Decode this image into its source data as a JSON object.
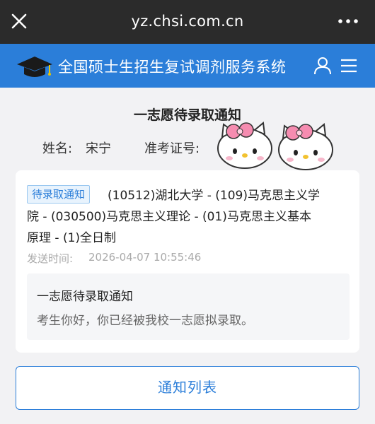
{
  "browser": {
    "url": "yz.chsi.com.cn",
    "close_icon": "close-icon",
    "more_icon": "more-horizontal-icon"
  },
  "header": {
    "title": "全国硕士生招生复试调剂服务系统",
    "logo_icon": "graduation-cap-icon",
    "user_icon": "user-icon",
    "menu_icon": "menu-icon",
    "color": "#2b7ed9"
  },
  "page": {
    "title": "一志愿待录取通知",
    "name_label": "姓名:",
    "name_value": "宋宁",
    "exam_no_label": "准考证号:"
  },
  "notice": {
    "badge": "待录取通知",
    "line1": "(10512)湖北大学 - (109)马克思主义学",
    "line2": "院 - (030500)马克思主义理论 - (01)马克思主义基本",
    "line3": "原理 - (1)全日制",
    "send_label": "发送时间:",
    "send_time": "2026-04-07 10:55:46",
    "message_title": "一志愿待录取通知",
    "message_body": "考生你好，你已经被我校一志愿拟录取。"
  },
  "actions": {
    "list_button": "通知列表"
  },
  "colors": {
    "accent": "#2b7ed9",
    "topbar": "#2b2b2b",
    "background": "#f2f2f4"
  }
}
